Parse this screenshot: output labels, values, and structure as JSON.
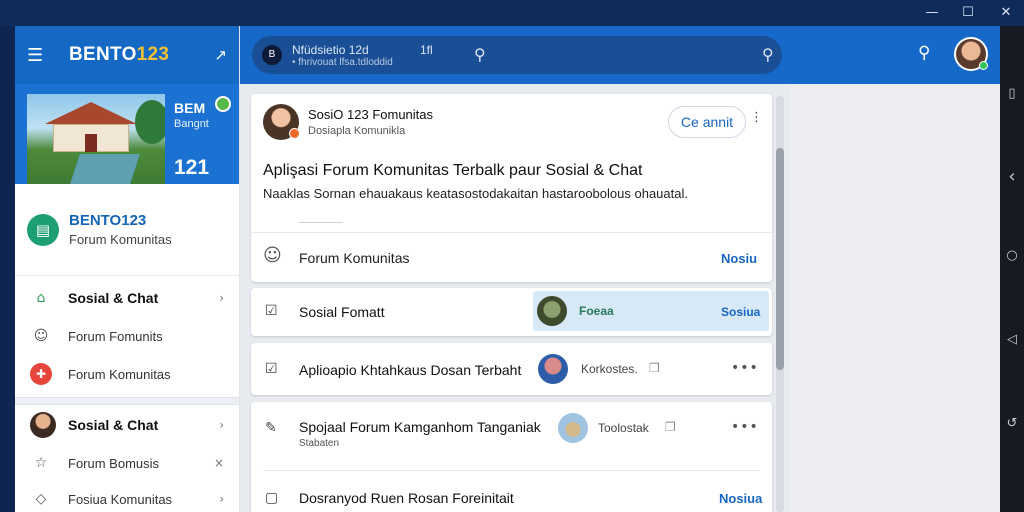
{
  "window": {
    "minimize_glyph": "—",
    "maximize_glyph": "☐",
    "close_glyph": "✕"
  },
  "android_nav": {
    "menu_glyph": "▯",
    "back_glyph": "‹",
    "home_glyph": "○",
    "recents_glyph": "◁",
    "rotate_glyph": "↺"
  },
  "sidebar": {
    "menu_icon": "☰",
    "brand_text": "BENTO",
    "brand_accent": "123",
    "collapse_icon": "↗",
    "promo": {
      "title": "BEM",
      "subtitle": "Bangnt",
      "number": "121"
    },
    "profile": {
      "icon": "▤",
      "name": "BENTO123",
      "subtitle": "Forum Komunitas"
    },
    "section1": [
      {
        "icon": "⌂",
        "label": "Sosial & Chat",
        "bold": true,
        "chevron": "›"
      },
      {
        "icon": "☺",
        "label": "Forum Fomunits",
        "bold": false
      },
      {
        "icon": "✚",
        "label": "Forum Komunitas",
        "bold": false
      }
    ],
    "section2": [
      {
        "label": "Sosial & Chat",
        "bold": true,
        "chevron": "›"
      },
      {
        "icon": "☆",
        "label": "Forum Bomusis",
        "bold": false,
        "chevron": "×"
      },
      {
        "icon": "◇",
        "label": "Fosiua Komunitas",
        "bold": false,
        "chevron": "›"
      }
    ]
  },
  "appbar": {
    "search_logo": "B",
    "search_line1": "Nfüdsietio 12d",
    "search_line2": "• fhrivouat lfsa.tdloddid",
    "search_num": "1fl",
    "search_glyph": "⚲",
    "search_glyph_right": "⚲",
    "search_icon": "⚲"
  },
  "feed": {
    "post": {
      "author": "SosiO 123  Fomunitas",
      "community": "Dosiapla Komunikla",
      "button_label": "Ce annit",
      "more": "⋮",
      "title": "Aplişasi Forum Komunitas Terbalk paur Sosial & Chat",
      "body": "Naaklas Sornan ehauakaus keatasostodakaitan hastaroobolous ohauatal.",
      "face_icon": "☺",
      "forum_label": "Forum Komunitas",
      "link": "Nosiu"
    },
    "rows": [
      {
        "icon": "☑",
        "title": "Sosial Fomatt",
        "chip_label": "Foeaa",
        "chip_link": "Sosiua"
      },
      {
        "icon": "☑",
        "title": "Aplioapio Khtahkaus Dosan Terbaht",
        "meta": "Korkostes.",
        "doc": "❐",
        "dots": "•••"
      },
      {
        "icon": "✎",
        "title": "Spojaal Forum Kamganhom Tanganiak",
        "subtitle": "Stabaten",
        "meta": "Toolostak",
        "doc": "❐",
        "dots": "•••"
      },
      {
        "icon": "▢",
        "title": "Dosranyod Ruen Rosan Foreinitait",
        "link": "Nosiua"
      }
    ]
  }
}
